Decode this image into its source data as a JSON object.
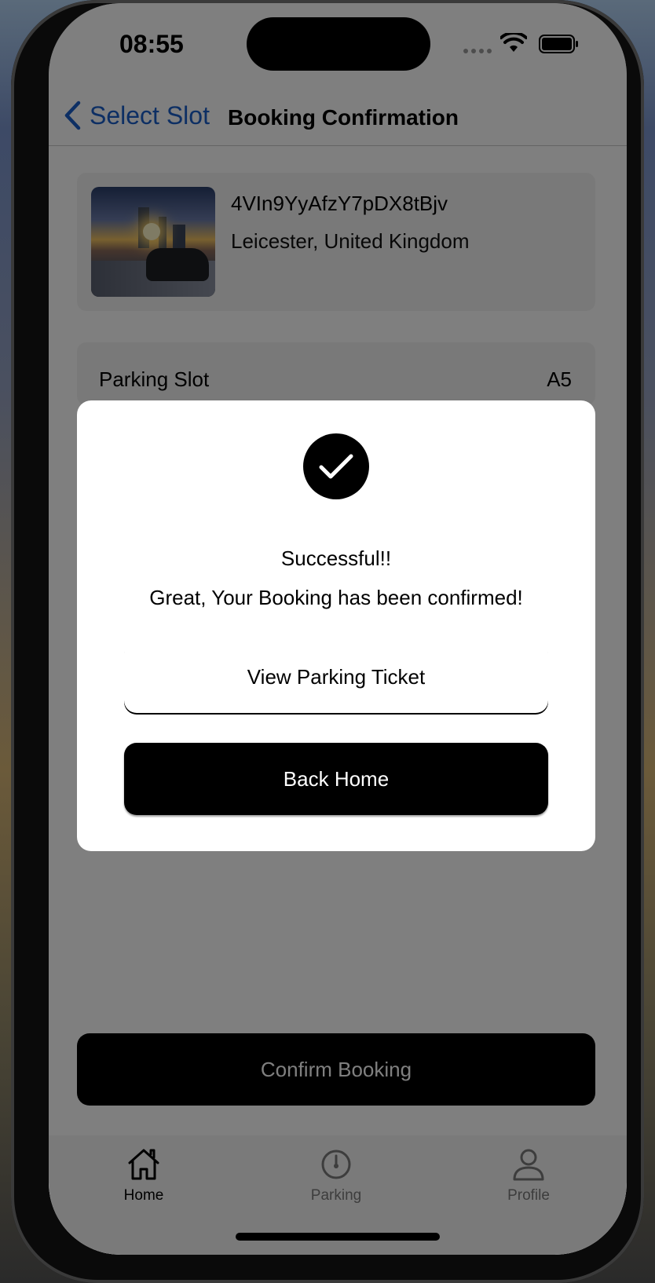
{
  "status_bar": {
    "time": "08:55"
  },
  "nav": {
    "back_label": "Select Slot",
    "title": "Booking Confirmation"
  },
  "lot": {
    "name": "4VIn9YyAfzY7pDX8tBjv",
    "location": "Leicester, United Kingdom"
  },
  "slot": {
    "label": "Parking Slot",
    "value": "A5"
  },
  "confirm_button": "Confirm Booking",
  "modal": {
    "icon": "checkmark-circle-icon",
    "title": "Successful!!",
    "message": "Great, Your Booking has been confirmed!",
    "ticket_button": "View Parking Ticket",
    "home_button": "Back Home"
  },
  "tabs": [
    {
      "label": "Home",
      "icon": "home-icon",
      "active": true
    },
    {
      "label": "Parking",
      "icon": "parking-timer-icon",
      "active": false
    },
    {
      "label": "Profile",
      "icon": "profile-icon",
      "active": false
    }
  ],
  "colors": {
    "accent": "#1a5ec8",
    "primary_button": "#000000",
    "overlay": "rgba(0,0,0,0.5)"
  }
}
